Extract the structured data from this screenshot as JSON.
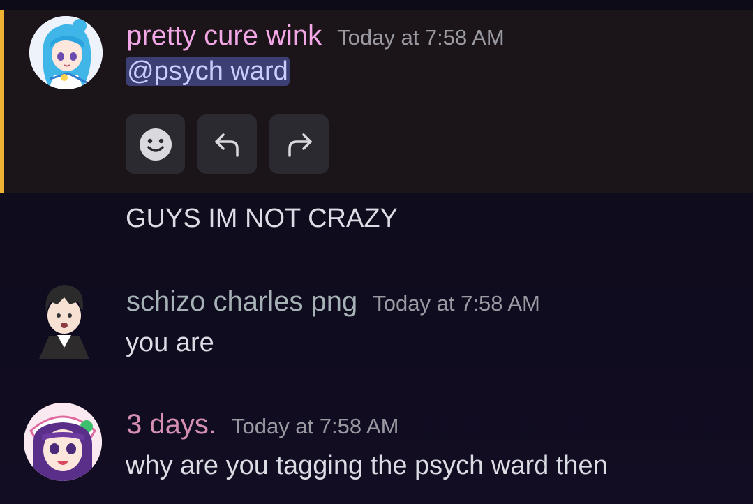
{
  "messages": [
    {
      "username": "pretty cure wink",
      "username_color": "#f2a8e6",
      "timestamp": "Today at 7:58 AM",
      "mention": "@psych ward",
      "actions": [
        "smiley-icon",
        "reply-icon",
        "forward-icon"
      ]
    },
    {
      "content": "GUYS IM NOT CRAZY"
    },
    {
      "username": "schizo charles png",
      "username_color": "#a7b2b6",
      "timestamp": "Today at 7:58 AM",
      "content": "you are"
    },
    {
      "username": "3 days.",
      "username_color": "#d58fb2",
      "timestamp": "Today at 7:58 AM",
      "content": "why are you tagging the psych ward then"
    }
  ],
  "colors": {
    "highlight_bar": "#f0b232",
    "highlight_bg": "#1b1519",
    "mention_bg": "#3c3f74"
  }
}
